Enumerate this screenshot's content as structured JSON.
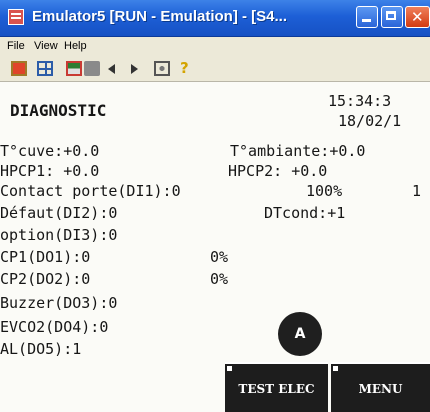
{
  "window": {
    "title": "Emulator5 [RUN - Emulation] - [S4..."
  },
  "menu": {
    "file": "File",
    "view": "View",
    "help": "Help"
  },
  "screen": {
    "heading": "DIAGNOSTIC",
    "time": "15:34:3",
    "date": "18/02/1",
    "lines": {
      "t_cuve": "T°cuve:+0.0",
      "t_ambiante": "T°ambiante:+0.0",
      "hpcp1": "HPCP1: +0.0",
      "hpcp2": "HPCP2: +0.0",
      "contact_porte": "Contact porte(DI1):0",
      "contact_pct": "100%",
      "contact_extra": "1",
      "defaut": "Défaut(DI2):0",
      "dtcond": "DTcond:+1",
      "option": "option(DI3):0",
      "cp1": "CP1(DO1):0",
      "cp1_pct": "0%",
      "cp2": "CP2(DO2):0",
      "cp2_pct": "0%",
      "buzzer": "Buzzer(DO3):0",
      "evco2": "EVCO2(DO4):0",
      "al": "AL(DO5):1"
    },
    "button_a": "A",
    "softkeys": {
      "test": "TEST ELEC",
      "menu": "MENU"
    }
  },
  "colors": {
    "titlebar": "#1d5fd6",
    "screen_bg": "#fbfbf7",
    "softkey_bg": "#1d1d1d"
  }
}
